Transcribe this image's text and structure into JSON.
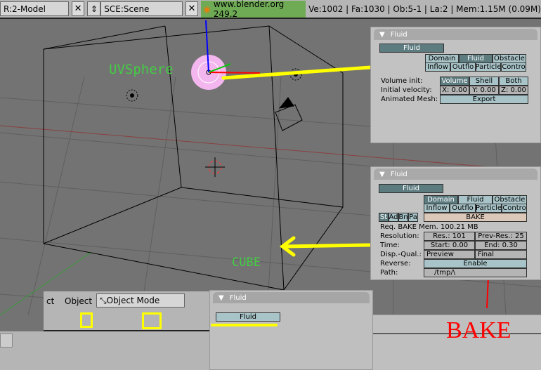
{
  "topbar": {
    "screen": "R:2-Model",
    "scene": "SCE:Scene",
    "version": "www.blender.org 249.2",
    "stats": "Ve:1002 | Fa:1030 | Ob:5-1 | La:2  | Mem:1.15M (0.09M)"
  },
  "viewport": {
    "object_label": "UVSphere",
    "cube_label": "CUBE",
    "bake_label": "BAKE",
    "colors": {
      "label": "#44cc44",
      "annotation": "#ffff00",
      "bake": "#ff0000"
    }
  },
  "panel_fluid_object": {
    "title": "Fluid",
    "toggle": "Fluid",
    "types": [
      "Domain",
      "Fluid",
      "Obstacle",
      "Inflow",
      "Outflo",
      "Particle",
      "Contro"
    ],
    "selected_type": "Fluid",
    "volume_init_label": "Volume init:",
    "volume_init_options": [
      "Volume",
      "Shell",
      "Both"
    ],
    "volume_init_selected": "Volume",
    "initial_velocity_label": "Initial velocity:",
    "velocity": [
      "X: 0.00",
      "Y: 0.00",
      "Z: 0.00"
    ],
    "animated_mesh_label": "Animated Mesh:",
    "export": "Export"
  },
  "panel_fluid_domain": {
    "title": "Fluid",
    "toggle": "Fluid",
    "types": [
      "Domain",
      "Fluid",
      "Obstacle",
      "Inflow",
      "Outflo",
      "Particle",
      "Contro"
    ],
    "selected_type": "Domain",
    "subtabs": [
      "St",
      "Ad",
      "Bn",
      "Pa"
    ],
    "bake": "BAKE",
    "mem": "Req. BAKE Mem. 100.21 MB",
    "resolution_label": "Resolution:",
    "res": "Res.: 101",
    "prev_res": "Prev-Res.: 25",
    "time_label": "Time:",
    "start": "Start: 0.00",
    "end": "End: 0.30",
    "disp_label": "Disp.-Qual.:",
    "disp_preview": "Preview",
    "disp_final": "Final",
    "reverse_label": "Reverse:",
    "enable": "Enable",
    "path_label": "Path:",
    "path": "/tmp/\\"
  },
  "header": {
    "menu_partial": "ct",
    "object_menu": "Object",
    "mode": "Object Mode"
  },
  "panel_fluid_bottom": {
    "title": "Fluid",
    "toggle": "Fluid"
  }
}
